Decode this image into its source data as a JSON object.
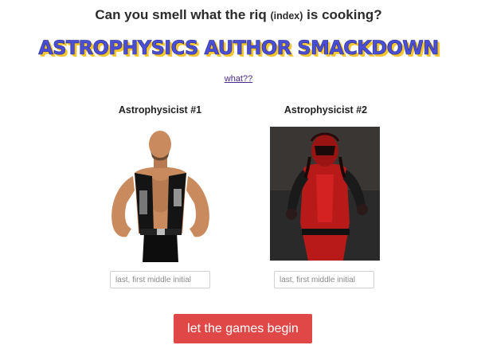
{
  "header": {
    "tagline_before": "Can you smell what the riq",
    "tagline_small": "(index)",
    "tagline_after": "is cooking?",
    "title": "ASTROPHYSICS AUTHOR SMACKDOWN",
    "help_link": "what??"
  },
  "contenders": [
    {
      "heading": "Astrophysicist #1",
      "image": "wrestler-portrait-1",
      "input_placeholder": "last, first middle initial",
      "input_value": ""
    },
    {
      "heading": "Astrophysicist #2",
      "image": "wrestler-portrait-2",
      "input_placeholder": "last, first middle initial",
      "input_value": ""
    }
  ],
  "submit": {
    "label": "let the games begin"
  },
  "colors": {
    "title": "#4a4fd6",
    "title_shadow": "#f3c530",
    "button": "#e04848",
    "link": "#4a2a8a"
  }
}
